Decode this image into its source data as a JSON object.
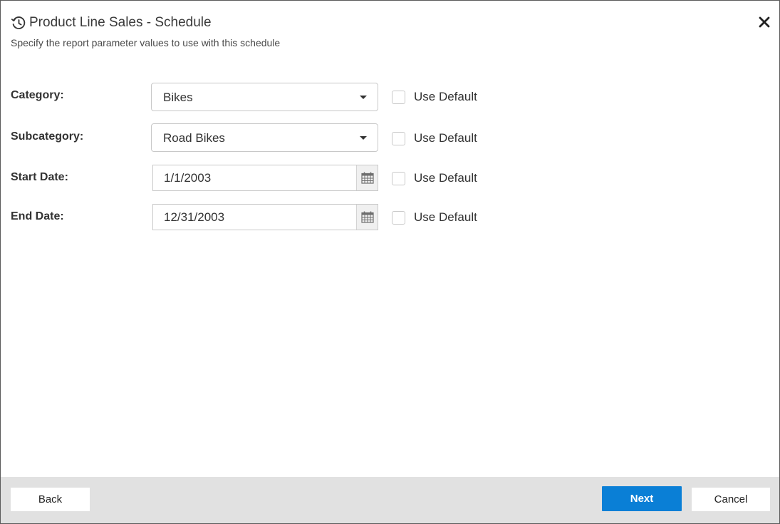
{
  "header": {
    "icon": "history-clock-icon",
    "title": "Product Line Sales - Schedule",
    "subtitle": "Specify the report parameter values to use with this schedule",
    "close_icon": "close-icon"
  },
  "parameters": [
    {
      "label": "Category:",
      "type": "dropdown",
      "value": "Bikes",
      "use_default_label": "Use Default",
      "use_default_checked": false
    },
    {
      "label": "Subcategory:",
      "type": "dropdown",
      "value": "Road Bikes",
      "use_default_label": "Use Default",
      "use_default_checked": false
    },
    {
      "label": "Start Date:",
      "type": "date",
      "value": "1/1/2003",
      "use_default_label": "Use Default",
      "use_default_checked": false
    },
    {
      "label": "End Date:",
      "type": "date",
      "value": "12/31/2003",
      "use_default_label": "Use Default",
      "use_default_checked": false
    }
  ],
  "footer": {
    "back_label": "Back",
    "next_label": "Next",
    "cancel_label": "Cancel"
  },
  "colors": {
    "primary": "#0a7fd6",
    "footer_bg": "#e1e1e1"
  }
}
